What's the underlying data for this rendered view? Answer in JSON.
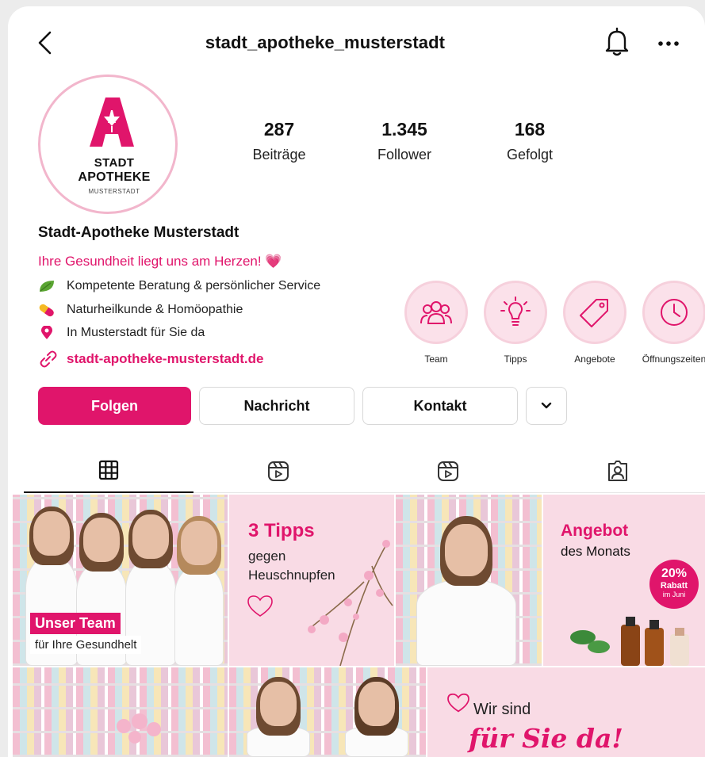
{
  "header": {
    "username": "stadt_apotheke_musterstadt"
  },
  "logo": {
    "line1": "STADT",
    "line2": "APOTHEKE",
    "line3": "MUSTERSTADT"
  },
  "stats": [
    {
      "value": "287",
      "label": "Beiträge"
    },
    {
      "value": "1.345",
      "label": "Follower"
    },
    {
      "value": "168",
      "label": "Gefolgt"
    }
  ],
  "bio": {
    "name": "Stadt-Apotheke Musterstadt",
    "tagline": "Ihre Gesundheit liegt uns am Herzen! 💗",
    "lines": [
      {
        "icon": "leaf-icon",
        "text": "Kompetente Beratung & persönlicher Service"
      },
      {
        "icon": "pill-icon",
        "text": "Naturheilkunde & Homöopathie"
      },
      {
        "icon": "location-pin-icon",
        "text": "In Musterstadt für Sie da"
      }
    ],
    "link": "stadt-apotheke-musterstadt.de"
  },
  "highlights": [
    {
      "icon": "team-icon",
      "label": "Team"
    },
    {
      "icon": "lightbulb-icon",
      "label": "Tipps"
    },
    {
      "icon": "tag-icon",
      "label": "Angebote"
    },
    {
      "icon": "clock-icon",
      "label": "Öffnungszeiten"
    }
  ],
  "actions": {
    "follow": "Folgen",
    "message": "Nachricht",
    "contact": "Kontakt"
  },
  "tabs": [
    {
      "icon": "grid-icon",
      "active": true
    },
    {
      "icon": "reels-icon",
      "active": false
    },
    {
      "icon": "reels-icon",
      "active": false
    },
    {
      "icon": "tagged-icon",
      "active": false
    }
  ],
  "posts": {
    "team": {
      "title": "Unser Team",
      "subtitle": "für Ihre Gesundhelt"
    },
    "tipps": {
      "title": "3 Tipps",
      "line2": "gegen",
      "line3": "Heuschnupfen"
    },
    "angebot": {
      "title": "Angebot",
      "subtitle": "des Monats",
      "percent": "20%",
      "rabatt": "Rabatt",
      "month": "im Juni"
    },
    "wir": {
      "line1": "Wir sind",
      "line2": "für Sie da!"
    }
  },
  "colors": {
    "accent": "#e0156b",
    "highlight_bg": "#fbe1ea",
    "post_bg_pink": "#f9dbe5"
  }
}
